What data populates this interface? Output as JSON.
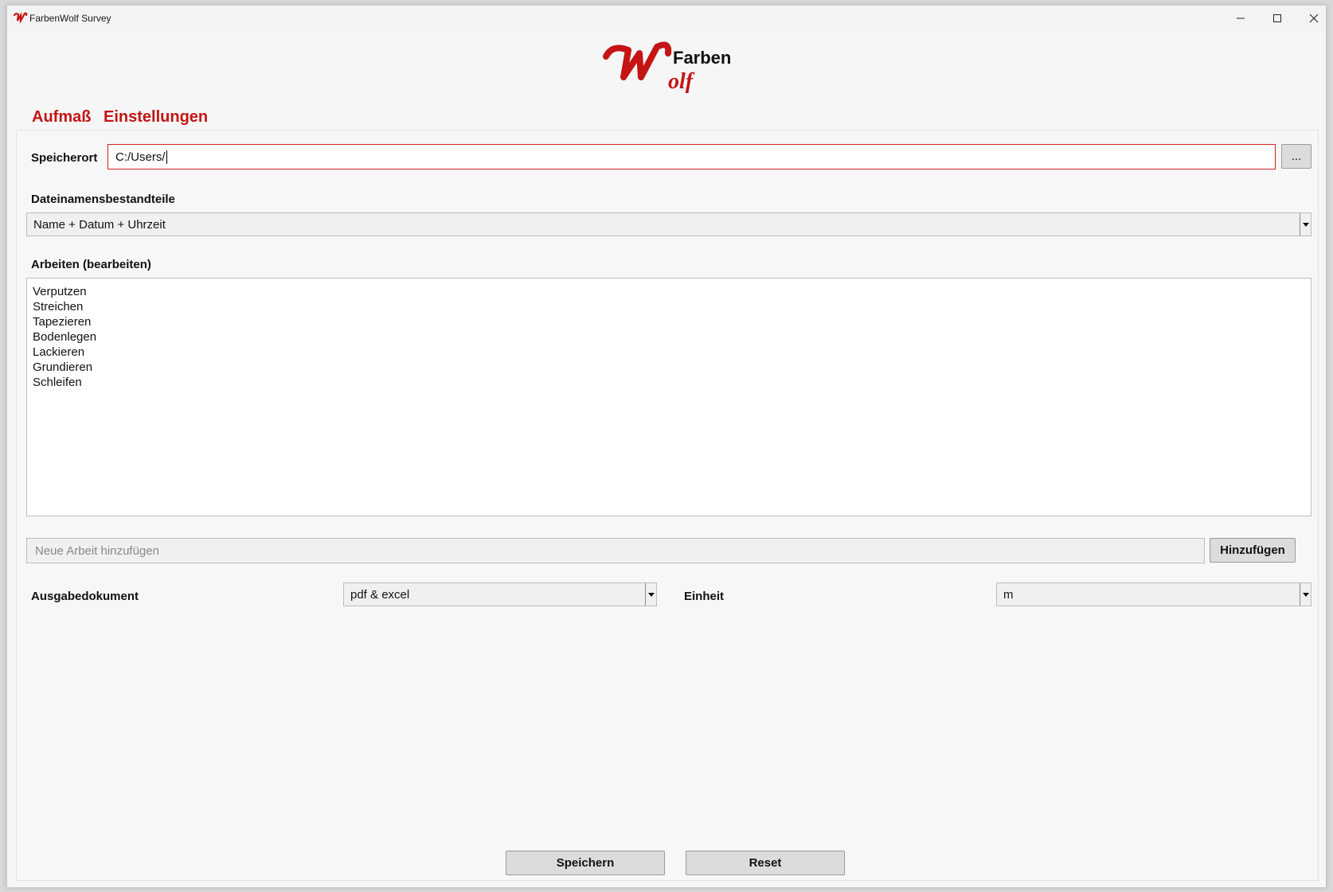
{
  "window": {
    "title": "FarbenWolf Survey"
  },
  "brand": {
    "logo_text_top": "Farben",
    "logo_text_bottom": "olf"
  },
  "tabs": [
    {
      "label": "Aufmaß",
      "active": false
    },
    {
      "label": "Einstellungen",
      "active": true
    }
  ],
  "settings": {
    "speicherort_label": "Speicherort",
    "speicherort_value": "C:/Users/",
    "browse_label": "...",
    "dateinamen_label": "Dateinamensbestandteile",
    "dateinamen_value": "Name + Datum + Uhrzeit",
    "arbeiten_label": "Arbeiten (bearbeiten)",
    "arbeiten_items": [
      "Verputzen",
      "Streichen",
      "Tapezieren",
      "Bodenlegen",
      "Lackieren",
      "Grundieren",
      "Schleifen"
    ],
    "neue_arbeit_placeholder": "Neue Arbeit hinzufügen",
    "hinzufuegen_label": "Hinzufügen",
    "ausgabe_label": "Ausgabedokument",
    "ausgabe_value": "pdf & excel",
    "einheit_label": "Einheit",
    "einheit_value": "m",
    "save_label": "Speichern",
    "reset_label": "Reset"
  },
  "colors": {
    "accent": "#c41414",
    "window_bg": "#f6f6f6"
  }
}
